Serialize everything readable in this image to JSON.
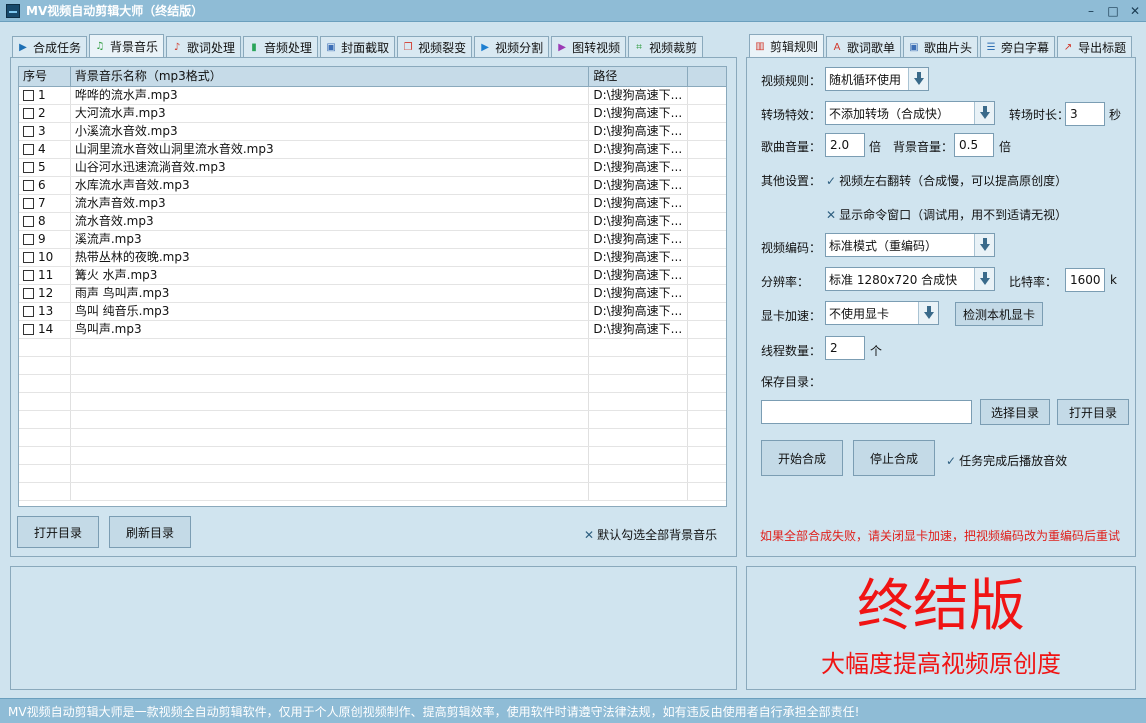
{
  "window": {
    "title": "MV视频自动剪辑大师（终结版）",
    "minimize": "–",
    "maximize": "□",
    "close": "✕"
  },
  "left_tabs": [
    {
      "label": "合成任务",
      "icon": "play-icon",
      "glyph": "▶",
      "color": "#1d6fb4"
    },
    {
      "label": "背景音乐",
      "icon": "music-note-icon",
      "glyph": "♫",
      "color": "#2a9a3a"
    },
    {
      "label": "歌词处理",
      "icon": "lyrics-icon",
      "glyph": "♪",
      "color": "#d23b2b"
    },
    {
      "label": "音频处理",
      "icon": "waveform-icon",
      "glyph": "▮",
      "color": "#2aa55a"
    },
    {
      "label": "封面截取",
      "icon": "image-icon",
      "glyph": "▣",
      "color": "#3d6fb6"
    },
    {
      "label": "视频裂变",
      "icon": "copy-icon",
      "glyph": "❐",
      "color": "#d2382b"
    },
    {
      "label": "视频分割",
      "icon": "video-split-icon",
      "glyph": "▶",
      "color": "#1d7fd1"
    },
    {
      "label": "图转视频",
      "icon": "slideshow-icon",
      "glyph": "▶",
      "color": "#9c3bb5"
    },
    {
      "label": "视频裁剪",
      "icon": "crop-icon",
      "glyph": "⌗",
      "color": "#2a9a3a"
    }
  ],
  "music_table": {
    "columns": [
      "序号",
      "背景音乐名称（mp3格式）",
      "路径"
    ],
    "rows": [
      {
        "no": "1",
        "name": "哗哗的流水声.mp3",
        "path": "D:\\搜狗高速下..."
      },
      {
        "no": "2",
        "name": "大河流水声.mp3",
        "path": "D:\\搜狗高速下..."
      },
      {
        "no": "3",
        "name": "小溪流水音效.mp3",
        "path": "D:\\搜狗高速下..."
      },
      {
        "no": "4",
        "name": "山洞里流水音效山洞里流水音效.mp3",
        "path": "D:\\搜狗高速下..."
      },
      {
        "no": "5",
        "name": "山谷河水迅速流淌音效.mp3",
        "path": "D:\\搜狗高速下..."
      },
      {
        "no": "6",
        "name": "水库流水声音效.mp3",
        "path": "D:\\搜狗高速下..."
      },
      {
        "no": "7",
        "name": "流水声音效.mp3",
        "path": "D:\\搜狗高速下..."
      },
      {
        "no": "8",
        "name": "流水音效.mp3",
        "path": "D:\\搜狗高速下..."
      },
      {
        "no": "9",
        "name": "溪流声.mp3",
        "path": "D:\\搜狗高速下..."
      },
      {
        "no": "10",
        "name": "热带丛林的夜晚.mp3",
        "path": "D:\\搜狗高速下..."
      },
      {
        "no": "11",
        "name": "篝火 水声.mp3",
        "path": "D:\\搜狗高速下..."
      },
      {
        "no": "12",
        "name": "雨声 鸟叫声.mp3",
        "path": "D:\\搜狗高速下..."
      },
      {
        "no": "13",
        "name": "鸟叫 纯音乐.mp3",
        "path": "D:\\搜狗高速下..."
      },
      {
        "no": "14",
        "name": "鸟叫声.mp3",
        "path": "D:\\搜狗高速下..."
      }
    ]
  },
  "left_actions": {
    "open_dir": "打开目录",
    "refresh_dir": "刷新目录",
    "select_all_mark": "✕",
    "select_all": "默认勾选全部背景音乐"
  },
  "right_tabs": [
    {
      "label": "剪辑规则",
      "icon": "film-icon",
      "glyph": "▥",
      "color": "#d2382b"
    },
    {
      "label": "歌词歌单",
      "icon": "font-icon",
      "glyph": "A",
      "color": "#d2382b"
    },
    {
      "label": "歌曲片头",
      "icon": "image-icon",
      "glyph": "▣",
      "color": "#3d6fb6"
    },
    {
      "label": "旁白字幕",
      "icon": "document-icon",
      "glyph": "☰",
      "color": "#2f6fb3"
    },
    {
      "label": "导出标题",
      "icon": "export-icon",
      "glyph": "↗",
      "color": "#d2382b"
    }
  ],
  "settings": {
    "video_rule_label": "视频规则：",
    "video_rule_value": "随机循环使用",
    "transition_label": "转场特效：",
    "transition_value": "不添加转场（合成快）",
    "transition_time_label": "转场时长：",
    "transition_time_value": "3",
    "transition_time_unit": "秒",
    "song_volume_label": "歌曲音量：",
    "song_volume_value": "2.0",
    "song_volume_unit": "倍",
    "bg_volume_label": "背景音量：",
    "bg_volume_value": "0.5",
    "bg_volume_unit": "倍",
    "other_label": "其他设置：",
    "flip_mark": "✓",
    "flip_option": "视频左右翻转（合成慢，可以提高原创度）",
    "console_mark": "✕",
    "console_option": "显示命令窗口（调试用，用不到适请无视）",
    "encoding_label": "视频编码：",
    "encoding_value": "标准模式（重编码）",
    "resolution_label": "分辨率：",
    "resolution_value": "标准 1280x720  合成快",
    "bitrate_label": "比特率：",
    "bitrate_value": "1600",
    "bitrate_unit": "k",
    "gpu_label": "显卡加速：",
    "gpu_value": "不使用显卡",
    "gpu_detect": "检测本机显卡",
    "threads_label": "线程数量：",
    "threads_value": "2",
    "threads_unit": "个",
    "save_dir_label": "保存目录：",
    "save_dir_value": "",
    "choose_dir": "选择目录",
    "open_dir": "打开目录",
    "start": "开始合成",
    "stop": "停止合成",
    "sound_mark": "✓",
    "sound_option": "任务完成后播放音效",
    "warning": "如果全部合成失败，请关闭显卡加速，把视频编码改为重编码后重试"
  },
  "brand": {
    "title": "终结版",
    "subtitle": "大幅度提高视频原创度"
  },
  "status": "MV视频自动剪辑大师是一款视频全自动剪辑软件，仅用于个人原创视频制作、提高剪辑效率，使用软件时请遵守法律法规，如有违反由使用者自行承担全部责任!"
}
